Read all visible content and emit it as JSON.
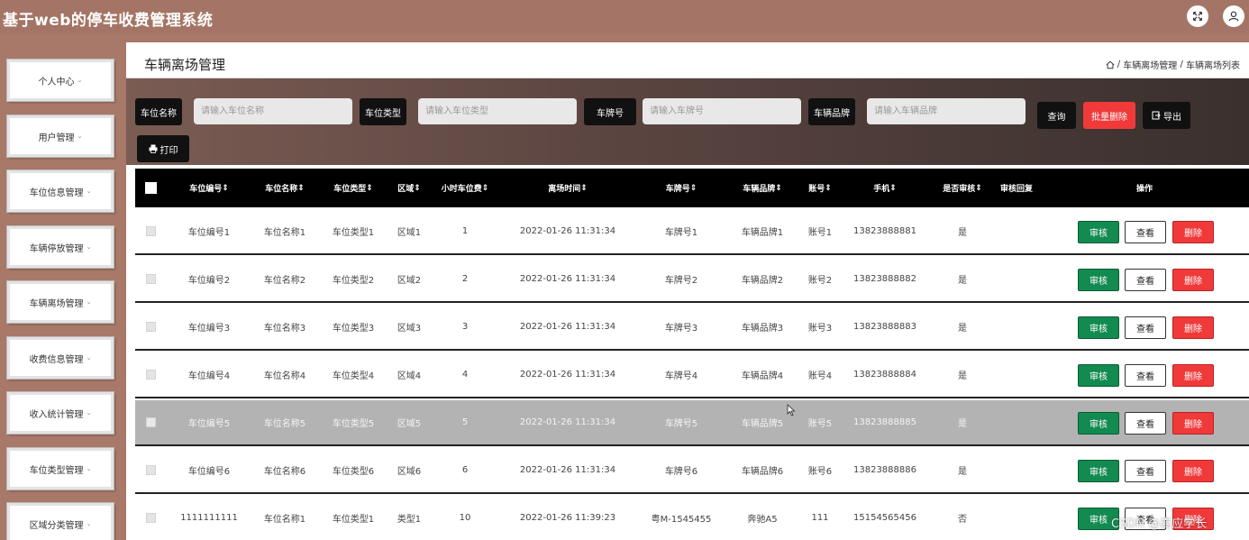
{
  "app": {
    "title": "基于web的停车收费管理系统",
    "fullscreen_icon": "fullscreen-icon",
    "user_icon": "user-icon"
  },
  "sidebar": {
    "items": [
      {
        "label": "个人中心"
      },
      {
        "label": "用户管理"
      },
      {
        "label": "车位信息管理"
      },
      {
        "label": "车辆停放管理"
      },
      {
        "label": "车辆离场管理"
      },
      {
        "label": "收费信息管理"
      },
      {
        "label": "收入统计管理"
      },
      {
        "label": "车位类型管理"
      },
      {
        "label": "区域分类管理"
      }
    ],
    "caret": "⌄"
  },
  "page": {
    "title": "车辆离场管理",
    "breadcrumb": {
      "home_icon": "home-icon",
      "level1": "车辆离场管理",
      "sep": "/",
      "level2": "车辆离场列表"
    }
  },
  "search": {
    "fields": [
      {
        "label": "车位名称",
        "placeholder": "请输入车位名称"
      },
      {
        "label": "车位类型",
        "placeholder": "请输入车位类型"
      },
      {
        "label": "车牌号",
        "placeholder": "请输入车牌号"
      },
      {
        "label": "车辆品牌",
        "placeholder": "请输入车辆品牌"
      }
    ],
    "query_label": "查询",
    "batch_delete_label": "批量删除",
    "export_label": "导出",
    "print_label": "打印"
  },
  "table": {
    "columns": [
      "车位编号",
      "车位名称",
      "车位类型",
      "区域",
      "小时车位费",
      "离场时间",
      "车牌号",
      "车辆品牌",
      "账号",
      "手机",
      "是否审核",
      "审核回复",
      "操作"
    ],
    "sort_mark": "⇕",
    "actions": {
      "audit": "审核",
      "view": "查看",
      "delete": "删除"
    },
    "rows": [
      [
        "车位编号1",
        "车位名称1",
        "车位类型1",
        "区域1",
        "1",
        "2022-01-26 11:31:34",
        "车牌号1",
        "车辆品牌1",
        "账号1",
        "13823888881",
        "是",
        ""
      ],
      [
        "车位编号2",
        "车位名称2",
        "车位类型2",
        "区域2",
        "2",
        "2022-01-26 11:31:34",
        "车牌号2",
        "车辆品牌2",
        "账号2",
        "13823888882",
        "是",
        ""
      ],
      [
        "车位编号3",
        "车位名称3",
        "车位类型3",
        "区域3",
        "3",
        "2022-01-26 11:31:34",
        "车牌号3",
        "车辆品牌3",
        "账号3",
        "13823888883",
        "是",
        ""
      ],
      [
        "车位编号4",
        "车位名称4",
        "车位类型4",
        "区域4",
        "4",
        "2022-01-26 11:31:34",
        "车牌号4",
        "车辆品牌4",
        "账号4",
        "13823888884",
        "是",
        ""
      ],
      [
        "车位编号5",
        "车位名称5",
        "车位类型5",
        "区域5",
        "5",
        "2022-01-26 11:31:34",
        "车牌号5",
        "车辆品牌5",
        "账号5",
        "13823888885",
        "是",
        ""
      ],
      [
        "车位编号6",
        "车位名称6",
        "车位类型6",
        "区域6",
        "6",
        "2022-01-26 11:31:34",
        "车牌号6",
        "车辆品牌6",
        "账号6",
        "13823888886",
        "是",
        ""
      ],
      [
        "1111111111",
        "车位名称1",
        "车位类型1",
        "类型1",
        "10",
        "2022-01-26 11:39:23",
        "粤M-1545455",
        "奔驰A5",
        "111",
        "15154565456",
        "否",
        ""
      ]
    ],
    "highlighted_row": 4
  },
  "watermark": "CSDN @嘉应学长"
}
